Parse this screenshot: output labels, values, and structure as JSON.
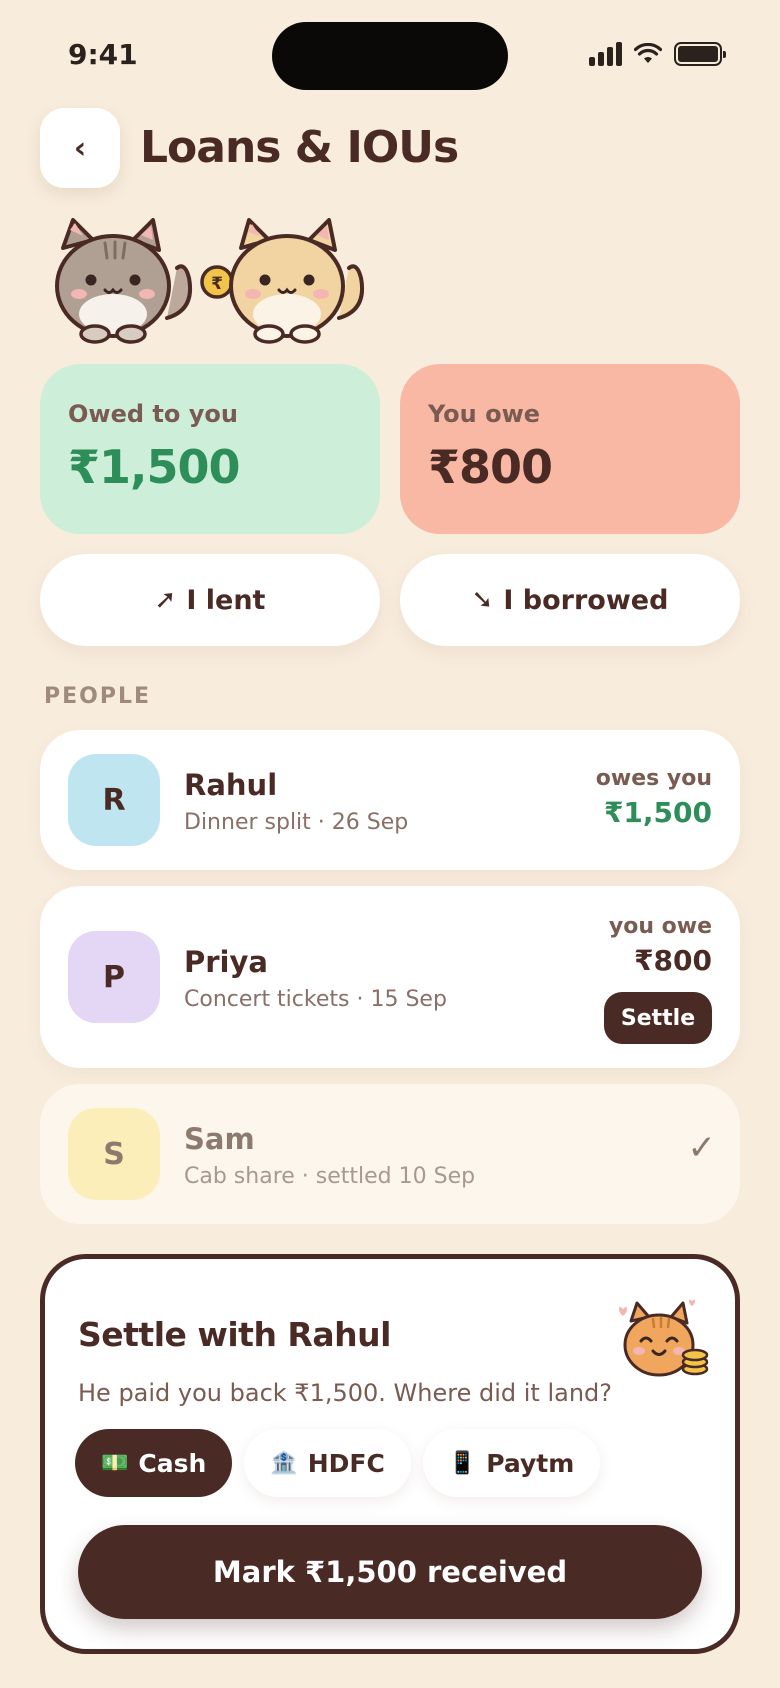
{
  "status_bar": {
    "time": "9:41"
  },
  "header": {
    "back_label": "‹",
    "title": "Loans & IOUs"
  },
  "summary": {
    "owed_label": "Owed to you",
    "owed_amount": "₹1,500",
    "owe_label": "You owe",
    "owe_amount": "₹800",
    "coin_symbol": "₹"
  },
  "actions": {
    "lent_icon": "➚",
    "lent_label": "I lent",
    "borrowed_icon": "➘",
    "borrowed_label": "I borrowed"
  },
  "people_section": {
    "label": "PEOPLE",
    "people": [
      {
        "initial": "R",
        "name": "Rahul",
        "detail": "Dinner split · 26 Sep",
        "caption": "owes you",
        "amount": "₹1,500"
      },
      {
        "initial": "P",
        "name": "Priya",
        "detail": "Concert tickets · 15 Sep",
        "caption": "you owe",
        "amount": "₹800",
        "action": "Settle"
      },
      {
        "initial": "S",
        "name": "Sam",
        "detail": "Cab share · settled 10 Sep",
        "status_icon": "✓"
      }
    ]
  },
  "settle_panel": {
    "title": "Settle with Rahul",
    "description": "He paid you back ₹1,500. Where did it land?",
    "methods": [
      {
        "icon": "💵",
        "label": "Cash",
        "selected": true
      },
      {
        "icon": "🏦",
        "label": "HDFC",
        "selected": false
      },
      {
        "icon": "📱",
        "label": "Paytm",
        "selected": false
      }
    ],
    "confirm_label": "Mark ₹1,500 received"
  },
  "colors": {
    "background": "#f8ecdc",
    "primary_dark": "#4a2a24",
    "owed_green": "#2e8e5a",
    "owed_card": "#cdeed9",
    "owe_card": "#f8b8a4"
  }
}
